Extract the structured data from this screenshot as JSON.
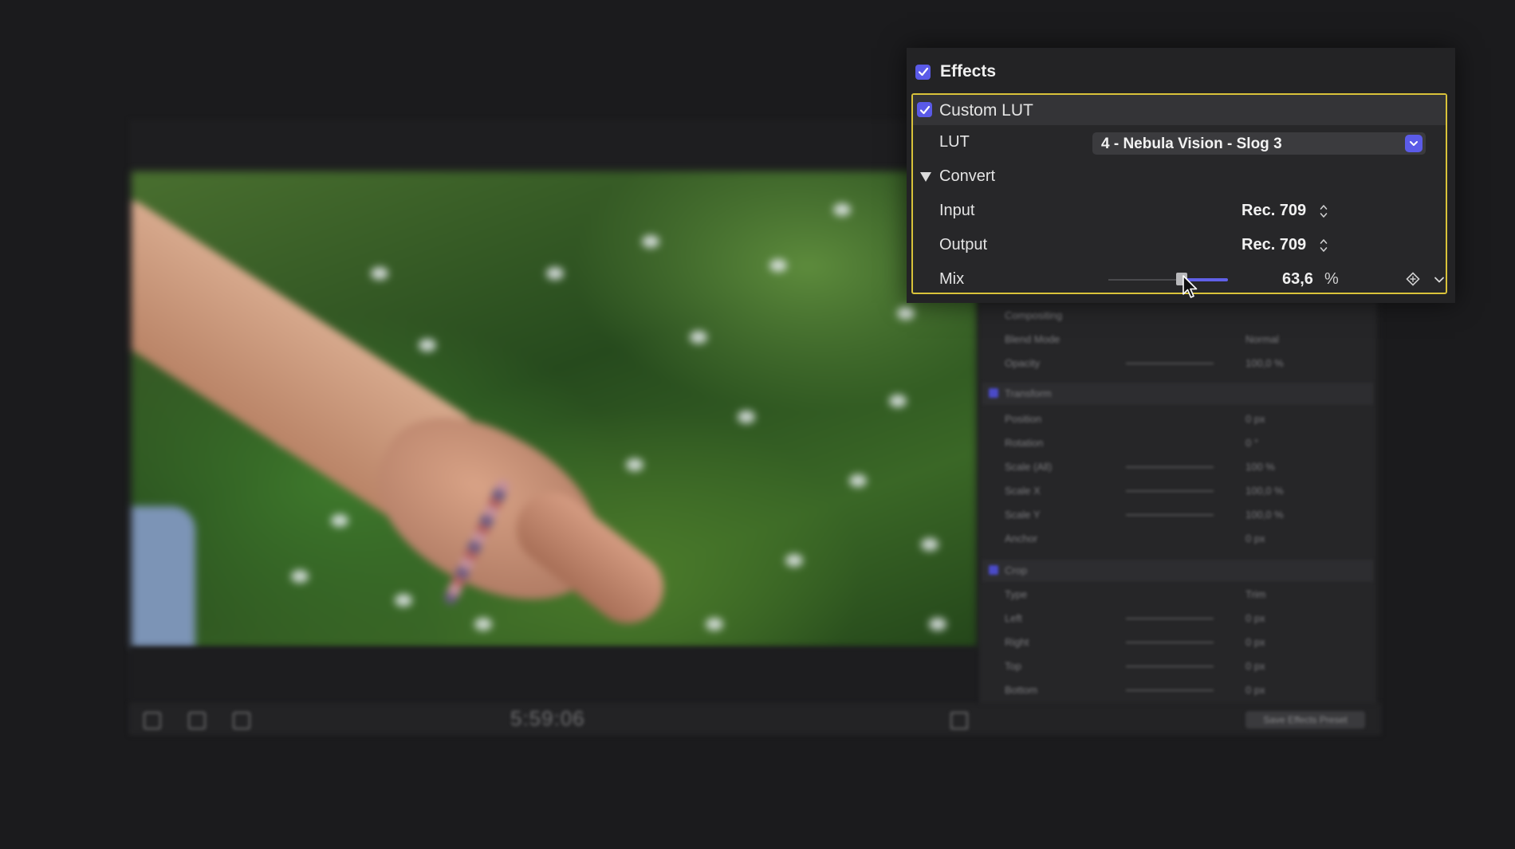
{
  "effects_panel": {
    "title": "Effects",
    "effect": {
      "name": "Custom LUT",
      "enabled": true,
      "lut": {
        "label": "LUT",
        "selected": "4 - Nebula Vision - Slog 3"
      },
      "convert": {
        "label": "Convert",
        "expanded": true
      },
      "input": {
        "label": "Input",
        "value": "Rec. 709"
      },
      "output": {
        "label": "Output",
        "value": "Rec. 709"
      },
      "mix": {
        "label": "Mix",
        "value": "63,6",
        "unit": "%",
        "fraction": 0.636
      }
    },
    "highlight_color": "#d9c23a",
    "accent_color": "#5a5ae8"
  },
  "background_inspector": {
    "sections": [
      {
        "label": "Compositing",
        "rows": [
          {
            "label": "Blend Mode",
            "value": "Normal"
          },
          {
            "label": "Opacity",
            "value": "100,0 %"
          }
        ]
      },
      {
        "label": "Transform",
        "rows": [
          {
            "label": "Position",
            "value": "0 px"
          },
          {
            "label": "Rotation",
            "value": "0 °"
          },
          {
            "label": "Scale (All)",
            "value": "100 %"
          },
          {
            "label": "Scale X",
            "value": "100,0 %"
          },
          {
            "label": "Scale Y",
            "value": "100,0 %"
          },
          {
            "label": "Anchor",
            "value": "0 px"
          }
        ]
      },
      {
        "label": "Crop",
        "rows": [
          {
            "label": "Type",
            "value": "Trim"
          },
          {
            "label": "Left",
            "value": "0 px"
          },
          {
            "label": "Right",
            "value": "0 px"
          },
          {
            "label": "Top",
            "value": "0 px"
          },
          {
            "label": "Bottom",
            "value": "0 px"
          }
        ]
      }
    ],
    "save_button": "Save Effects Preset"
  },
  "viewer": {
    "timecode": "5:59:06"
  },
  "icons": {
    "checkbox": "checkmark-icon",
    "dropdown": "chevron-down-icon",
    "stepper": "up-down-stepper-icon",
    "keyframe": "keyframe-diamond-icon",
    "cursor": "mouse-pointer-icon"
  }
}
